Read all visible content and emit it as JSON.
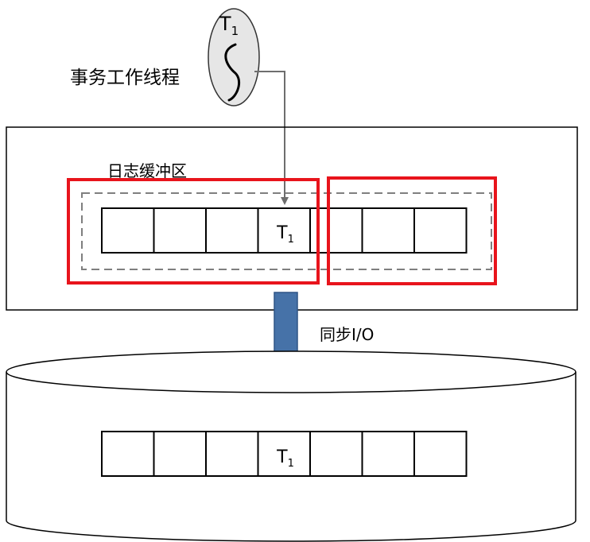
{
  "thread": {
    "label": "T",
    "label_sub": "1",
    "caption": "事务工作线程"
  },
  "log_buffer": {
    "label": "日志缓冲区",
    "cell_count": 7,
    "marked_cell": 4,
    "cell_label": "T",
    "cell_label_sub": "1"
  },
  "io": {
    "label": "同步I/O"
  },
  "disk": {
    "cell_count": 7,
    "marked_cell": 4,
    "cell_label": "T",
    "cell_label_sub": "1"
  },
  "colors": {
    "highlight": "#e8141c",
    "dashed": "#7f7f7f",
    "arrow_fill": "#4672a8",
    "arrow_stroke": "#2f5486",
    "thread_fill": "#e6e6e6",
    "connector": "#6e6e6e"
  }
}
